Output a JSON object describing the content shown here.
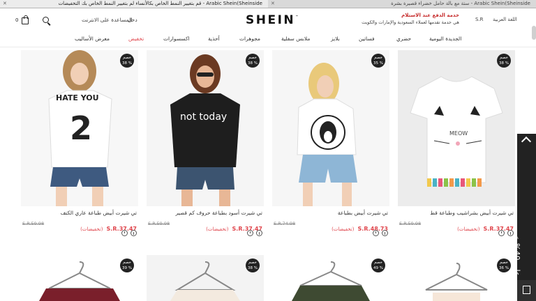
{
  "browser": {
    "tabs": [
      {
        "title": "Arabic Shein(Sheinside - قم بتغيير النمط الخاص بكالأنساء لم بتغيير النمط الخاص بك التخفيضات",
        "active": true
      },
      {
        "title": "Arabic Shein(Sheinside - ستة مع بالة حامل خضراء قصيرة بشرة",
        "active": false
      }
    ]
  },
  "header": {
    "cart_count": "0",
    "help_label": "المساعدة على الانترنت",
    "signin_label": "دخل",
    "logo": "SHEIN",
    "logo_mark": "™",
    "promo_title": "خدمة الدفع عند الاستلام",
    "promo_text": "هي خدمة تقدمها لعملاء السعودية والإمارات والكويت",
    "currency": "S.R",
    "language": "اللغة العربية"
  },
  "nav": {
    "items": [
      "الجديدة اليومية",
      "حضري",
      "فساتين",
      "بلايز",
      "ملابس سفلية",
      "مجوهرات",
      "أحذية",
      "اكسسوارات",
      "تخفيض",
      "معرض الأساليب"
    ],
    "sale_index": 8
  },
  "products": [
    {
      "name": "تي شيرت أبيض بشراشيب وطباعة قط",
      "discount_label": "خصم",
      "discount": "38 %",
      "sale_price": "S.R.37.47",
      "sale_tag": "(تخفيضات)",
      "orig_price": "S.R.59.98"
    },
    {
      "name": "تي شيرت أبيض بطباعة",
      "discount_label": "خصم",
      "discount": "35 %",
      "sale_price": "S.R.48.73",
      "sale_tag": "(تخفيضات)",
      "orig_price": "S.R.74.98"
    },
    {
      "name": "تي شيرت أسود بطباعة حروف كم قصير",
      "discount_label": "خصم",
      "discount": "38 %",
      "sale_price": "S.R.37.47",
      "sale_tag": "(تخفيضات)",
      "orig_price": "S.R.59.98"
    },
    {
      "name": "تي شيرت أبيض طباعة عاري الكتف",
      "discount_label": "خصم",
      "discount": "38 %",
      "sale_price": "S.R.37.47",
      "sale_tag": "(تخفيضات)",
      "orig_price": "S.R.59.98"
    }
  ],
  "row2_badges": [
    {
      "label": "خصم",
      "value": "36 %"
    },
    {
      "label": "خصم",
      "value": "49 %"
    },
    {
      "label": "خصم",
      "value": "38 %"
    },
    {
      "label": "خصم",
      "value": "39 %"
    }
  ],
  "side_tab": {
    "text": "تحصل على 40% خصم"
  },
  "colors": {
    "accent": "#e0464d",
    "badge": "#222222",
    "side_tab": "#222222"
  },
  "icons": [
    "cart-icon",
    "search-icon",
    "clock-icon",
    "info-icon",
    "chevron-up-icon",
    "window-icon"
  ]
}
